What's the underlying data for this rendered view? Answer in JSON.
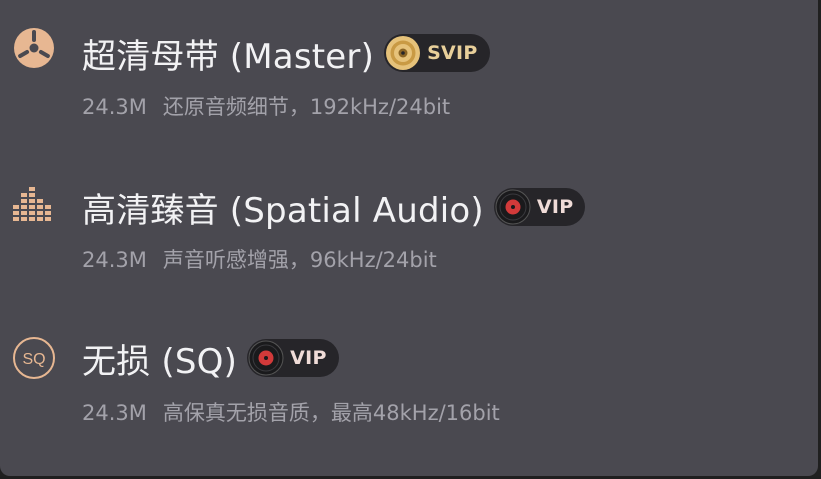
{
  "options": [
    {
      "title": "超清母带 (Master)",
      "icon": "master-reel-icon",
      "badge": "SVIP",
      "size": "24.3M",
      "description": "还原音频细节，192kHz/24bit"
    },
    {
      "title": "高清臻音 (Spatial Audio)",
      "icon": "spatial-bars-icon",
      "badge": "VIP",
      "size": "24.3M",
      "description": "声音听感增强，96kHz/24bit"
    },
    {
      "title": "无损 (SQ)",
      "icon": "sq-circle-icon",
      "icon_text": "SQ",
      "badge": "VIP",
      "size": "24.3M",
      "description": "高保真无损音质，最高48kHz/16bit"
    }
  ],
  "colors": {
    "panel": "#4a4950",
    "title": "#f2f2f4",
    "desc": "#a3a2aa",
    "icon_accent": "#e7b792",
    "svip_gold": "#e8cf9a",
    "vip_red": "#d23a3a",
    "badge_bg": "#262529"
  }
}
